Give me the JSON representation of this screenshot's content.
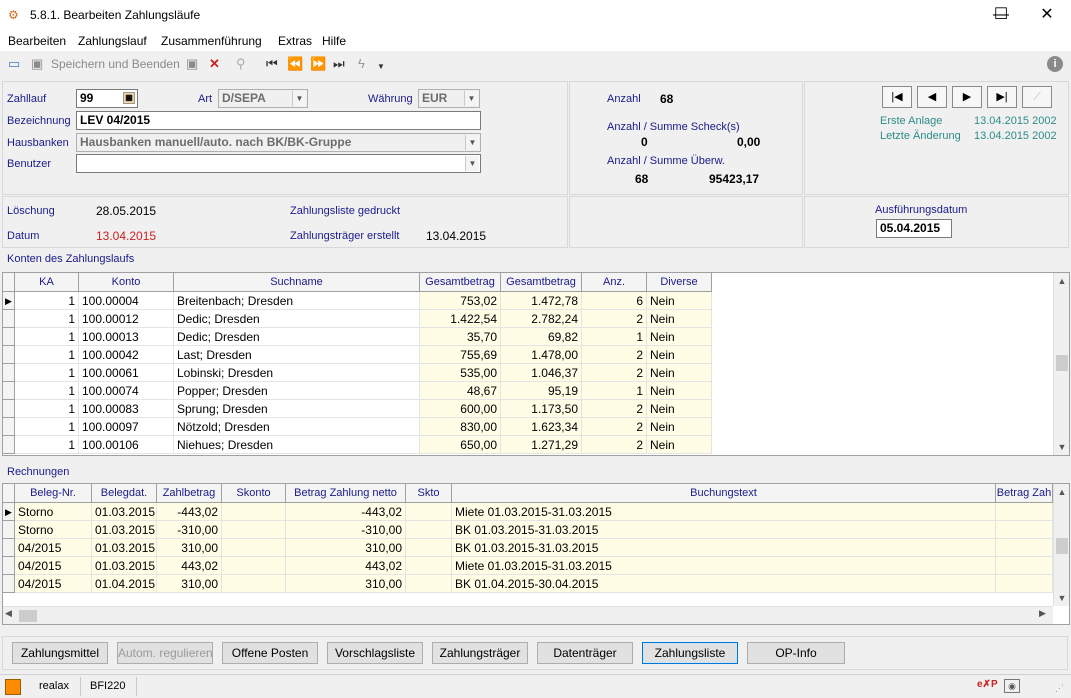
{
  "window": {
    "title": "5.8.1. Bearbeiten Zahlungsläufe",
    "minimize_glyph": "—",
    "maximize_glyph": "☐",
    "close_glyph": "✕"
  },
  "menu": [
    "Bearbeiten",
    "Zahlungslauf",
    "Zusammenführung",
    "Extras",
    "Hilfe"
  ],
  "toolbar": {
    "save_and_exit_label": "Speichern und Beenden"
  },
  "header": {
    "zahllauf_label": "Zahllauf",
    "zahllauf_value": "99",
    "art_label": "Art",
    "art_value": "D/SEPA",
    "waehrung_label": "Währung",
    "waehrung_value": "EUR",
    "bezeichnung_label": "Bezeichnung",
    "bezeichnung_value": "LEV 04/2015",
    "hausbanken_label": "Hausbanken",
    "hausbanken_value": "Hausbanken manuell/auto. nach BK/BK-Gruppe",
    "benutzer_label": "Benutzer",
    "benutzer_value": ""
  },
  "summary": {
    "anzahl_label": "Anzahl",
    "anzahl_value": "68",
    "scheck_label": "Anzahl / Summe Scheck(s)",
    "scheck_count": "0",
    "scheck_sum": "0,00",
    "ueberw_label": "Anzahl / Summe Überw.",
    "ueberw_count": "68",
    "ueberw_sum": "95423,17"
  },
  "meta": {
    "erste_anlage_label": "Erste Anlage",
    "erste_anlage_value": "13.04.2015 2002",
    "letzte_aenderung_label": "Letzte Änderung",
    "letzte_aenderung_value": "13.04.2015 2002"
  },
  "dates": {
    "loeschung_label": "Löschung",
    "loeschung_value": "28.05.2015",
    "datum_label": "Datum",
    "datum_value": "13.04.2015",
    "zahlungsliste_gedruckt_label": "Zahlungsliste gedruckt",
    "zahlungstraeger_erstellt_label": "Zahlungsträger erstellt",
    "zahlungstraeger_erstellt_value": "13.04.2015",
    "ausfuehrungsdatum_label": "Ausführungsdatum",
    "ausfuehrungsdatum_value": "05.04.2015"
  },
  "konten": {
    "section_label": "Konten des Zahlungslaufs",
    "columns": [
      "KA",
      "Konto",
      "Suchname",
      "Gesamtbetrag",
      "Gesamtbetrag",
      "Anz.",
      "Diverse"
    ],
    "rows": [
      [
        "1",
        "100.00004",
        "Breitenbach; Dresden",
        "753,02",
        "1.472,78",
        "6",
        "Nein"
      ],
      [
        "1",
        "100.00012",
        "Dedic; Dresden",
        "1.422,54",
        "2.782,24",
        "2",
        "Nein"
      ],
      [
        "1",
        "100.00013",
        "Dedic; Dresden",
        "35,70",
        "69,82",
        "1",
        "Nein"
      ],
      [
        "1",
        "100.00042",
        "Last; Dresden",
        "755,69",
        "1.478,00",
        "2",
        "Nein"
      ],
      [
        "1",
        "100.00061",
        "Lobinski; Dresden",
        "535,00",
        "1.046,37",
        "2",
        "Nein"
      ],
      [
        "1",
        "100.00074",
        "Popper; Dresden",
        "48,67",
        "95,19",
        "1",
        "Nein"
      ],
      [
        "1",
        "100.00083",
        "Sprung; Dresden",
        "600,00",
        "1.173,50",
        "2",
        "Nein"
      ],
      [
        "1",
        "100.00097",
        "Nötzold; Dresden",
        "830,00",
        "1.623,34",
        "2",
        "Nein"
      ],
      [
        "1",
        "100.00106",
        "Niehues; Dresden",
        "650,00",
        "1.271,29",
        "2",
        "Nein"
      ]
    ]
  },
  "rechnungen": {
    "section_label": "Rechnungen",
    "columns": [
      "Beleg-Nr.",
      "Belegdat.",
      "Zahlbetrag",
      "Skonto",
      "Betrag Zahlung netto",
      "Skto",
      "Buchungstext",
      "Betrag Zah"
    ],
    "rows": [
      [
        "Storno",
        "01.03.2015",
        "-443,02",
        "",
        "-443,02",
        "",
        "Miete 01.03.2015-31.03.2015",
        ""
      ],
      [
        "Storno",
        "01.03.2015",
        "-310,00",
        "",
        "-310,00",
        "",
        "BK 01.03.2015-31.03.2015",
        ""
      ],
      [
        "04/2015",
        "01.03.2015",
        "310,00",
        "",
        "310,00",
        "",
        "BK 01.03.2015-31.03.2015",
        ""
      ],
      [
        "04/2015",
        "01.03.2015",
        "443,02",
        "",
        "443,02",
        "",
        "Miete 01.03.2015-31.03.2015",
        ""
      ],
      [
        "04/2015",
        "01.04.2015",
        "310,00",
        "",
        "310,00",
        "",
        "BK 01.04.2015-30.04.2015",
        ""
      ]
    ]
  },
  "buttons": {
    "zahlungsmittel": "Zahlungsmittel",
    "autom_regulieren": "Autom. regulieren",
    "offene_posten": "Offene Posten",
    "vorschlagsliste": "Vorschlagsliste",
    "zahlungstraeger": "Zahlungsträger",
    "datentraeger": "Datenträger",
    "zahlungsliste": "Zahlungsliste",
    "op_info": "OP-Info"
  },
  "status": {
    "user": "realax",
    "code": "BFI220",
    "accent": "#ff8c00"
  }
}
